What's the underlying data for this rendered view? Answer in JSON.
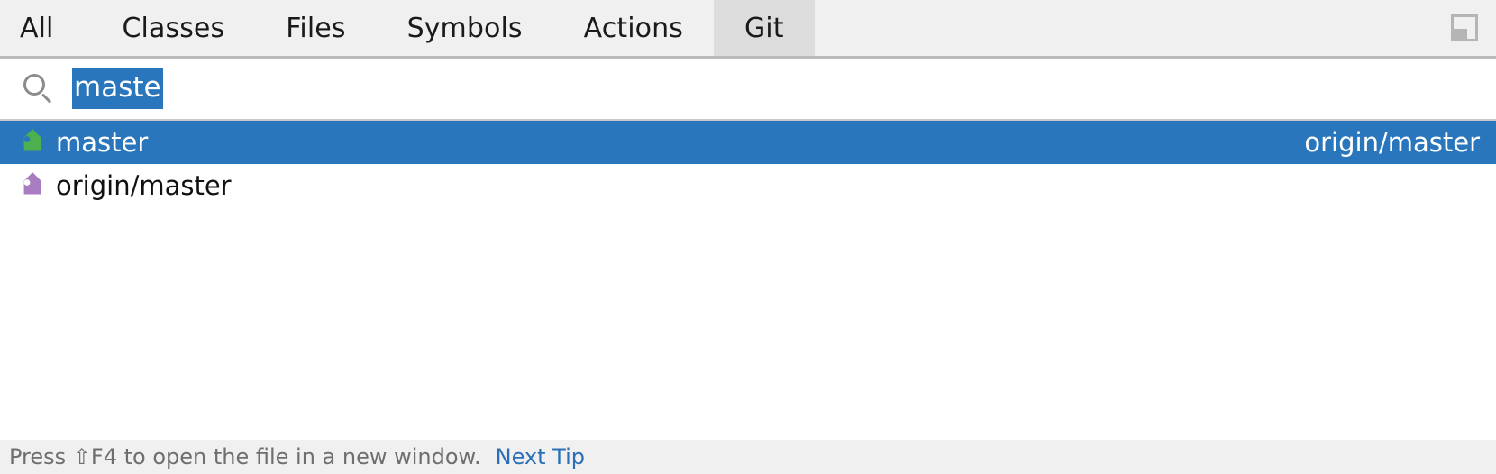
{
  "window": {
    "kind": "search-everywhere-popup"
  },
  "tabs": {
    "items": [
      {
        "label": "All",
        "selected": false
      },
      {
        "label": "Classes",
        "selected": false
      },
      {
        "label": "Files",
        "selected": false
      },
      {
        "label": "Symbols",
        "selected": false
      },
      {
        "label": "Actions",
        "selected": false
      },
      {
        "label": "Git",
        "selected": true
      }
    ],
    "preview_toggle_icon": "preview-panel-icon"
  },
  "search": {
    "icon": "search-icon",
    "value": "maste",
    "placeholder": "",
    "selection_color": "#2a76bd"
  },
  "results": {
    "items": [
      {
        "icon": "green-tag-icon",
        "icon_color": "#4caf50",
        "label": "master",
        "meta": "origin/master",
        "selected": true
      },
      {
        "icon": "purple-tag-icon",
        "icon_color": "#a77cc0",
        "label": "origin/master",
        "meta": "",
        "selected": false
      }
    ],
    "selection_color": "#2a76bd"
  },
  "statusbar": {
    "tip_text": "Press ⇧F4 to open the file in a new window.",
    "link_label": "Next Tip",
    "link_color": "#2a6fb8"
  }
}
